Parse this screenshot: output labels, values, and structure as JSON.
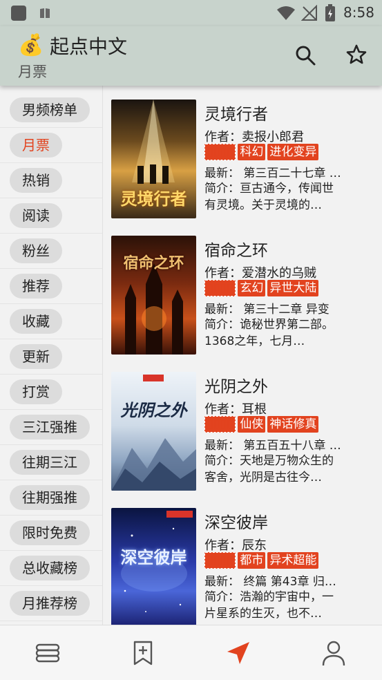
{
  "status_bar": {
    "time": "8:58"
  },
  "header": {
    "logo": "💰",
    "title": "起点中文",
    "subtitle": "月票"
  },
  "sidebar": {
    "items": [
      {
        "label": "男频榜单",
        "active": false
      },
      {
        "label": "月票",
        "active": true
      },
      {
        "label": "热销",
        "active": false
      },
      {
        "label": "阅读",
        "active": false
      },
      {
        "label": "粉丝",
        "active": false
      },
      {
        "label": "推荐",
        "active": false
      },
      {
        "label": "收藏",
        "active": false
      },
      {
        "label": "更新",
        "active": false
      },
      {
        "label": "打赏",
        "active": false
      },
      {
        "label": "三江强推",
        "active": false
      },
      {
        "label": "往期三江",
        "active": false
      },
      {
        "label": "往期强推",
        "active": false
      },
      {
        "label": "限时免费",
        "active": false
      },
      {
        "label": "总收藏榜",
        "active": false
      },
      {
        "label": "月推荐榜",
        "active": false
      }
    ]
  },
  "books": [
    {
      "title": "灵境行者",
      "author": "作者：卖报小郎君",
      "tags": [
        "科幻",
        "进化变异"
      ],
      "latest": "最新： 第三百二十七章 …",
      "intro": "简介：亘古通今，传闻世有灵境。关于灵境的…",
      "cover_text": "灵境行者"
    },
    {
      "title": "宿命之环",
      "author": "作者：爱潜水的乌贼",
      "tags": [
        "玄幻",
        "异世大陆"
      ],
      "latest": "最新： 第三十二章 异变",
      "intro": "简介：诡秘世界第二部。1368之年，七月…",
      "cover_text": "宿命之环"
    },
    {
      "title": "光阴之外",
      "author": "作者：耳根",
      "tags": [
        "仙侠",
        "神话修真"
      ],
      "latest": "最新： 第五百五十八章 …",
      "intro": "简介：天地是万物众生的客舍，光阴是古往今…",
      "cover_text": "光阴之外"
    },
    {
      "title": "深空彼岸",
      "author": "作者：辰东",
      "tags": [
        "都市",
        "异术超能"
      ],
      "latest": "最新： 终篇 第43章 归…",
      "intro": "简介：浩瀚的宇宙中，一片星系的生灭，也不…",
      "cover_text": "深空彼岸"
    }
  ],
  "colors": {
    "accent": "#e2431f",
    "toolbar_bg": "#c8d3cc"
  },
  "icons": {
    "search": "search-icon",
    "star": "star-icon",
    "nav": [
      "bookshelf-icon",
      "bookmark-add-icon",
      "navigate-icon",
      "profile-icon"
    ]
  }
}
